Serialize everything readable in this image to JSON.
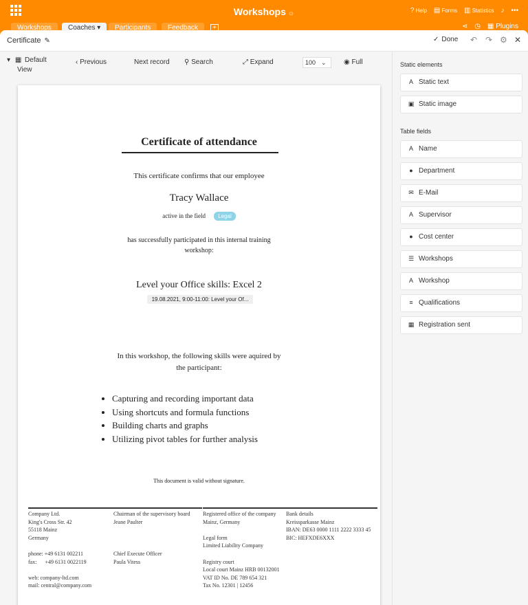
{
  "app": {
    "title": "Workshops",
    "title_icon": "☼"
  },
  "topbar": {
    "items": [
      {
        "icon": "?",
        "label": "Help"
      },
      {
        "icon": "▤",
        "label": "Forms"
      },
      {
        "icon": "▥",
        "label": "Statistics"
      },
      {
        "icon": "♪",
        "label": ""
      },
      {
        "icon": "•••",
        "label": ""
      }
    ]
  },
  "tabs": [
    {
      "label": "Workshops"
    },
    {
      "label": "Coaches ▾"
    },
    {
      "label": "Participants"
    },
    {
      "label": "Feedback"
    }
  ],
  "tabs_right": {
    "plugins": "Plugins"
  },
  "modal": {
    "title": "Certificate",
    "done": "Done",
    "check": "✓",
    "pen": "✎"
  },
  "toolbar": {
    "view": "Default",
    "view2": "View",
    "previous": "Previous",
    "next": "Next record",
    "search": "Search",
    "expand": "Expand",
    "zoom": "100",
    "full": "Full"
  },
  "certificate": {
    "title": "Certificate of attendance",
    "confirm": "This certificate confirms that our employee",
    "name": "Tracy Wallace",
    "field": "active in the field",
    "field_value": "Legal",
    "participated_1": "has successfully participated in this internal training",
    "participated_2": "workshop:",
    "workshop": "Level your Office skills: Excel 2",
    "workshop_date": "19.08.2021, 9:00-11:00: Level your Of...",
    "skills_intro_1": "In this workshop, the following skills were aquired by",
    "skills_intro_2": "the participant:",
    "skills": [
      "Capturing and recording important data",
      "Using shortcuts and formula functions",
      "Building charts and graphs",
      "Utilizing pivot tables for further analysis"
    ],
    "valid": "This document is valid without signature."
  },
  "footer": {
    "col1": [
      "Company Ltd.",
      "King's Cross Str. 42",
      "55118 Mainz",
      "Germany",
      "",
      "phone: +49 6131 002211",
      "fax:      +49 6131 0022119",
      "",
      "web: company-ltd.com",
      "mail: central@company.com"
    ],
    "col2": [
      "Chairman of the supervisory board",
      "Jeane Paulter",
      "",
      "",
      "",
      "Chief Execute Officer",
      "Paula Vitess"
    ],
    "col3": [
      "Registered office of the company",
      "Mainz, Germany",
      "",
      "Legal form",
      "Limited Liability Company",
      "",
      "Registry court",
      "Local court Mainz HRB 00132001",
      "VAT ID No. DE 789 654 321",
      "Tax No. 12301 | 12456"
    ],
    "col4": [
      "Bank details",
      "Kreissparkasse Mainz",
      "IBAN: DE63 0000 1111 2222 3333 45",
      "BIC: HEFXDE6XXX"
    ]
  },
  "rpanel": {
    "static_title": "Static elements",
    "static": [
      {
        "icon": "A",
        "label": "Static text"
      },
      {
        "icon": "▣",
        "label": "Static image"
      }
    ],
    "fields_title": "Table fields",
    "fields": [
      {
        "icon": "A",
        "label": "Name"
      },
      {
        "icon": "●",
        "label": "Department"
      },
      {
        "icon": "✉",
        "label": "E-Mail"
      },
      {
        "icon": "A",
        "label": "Supervisor"
      },
      {
        "icon": "●",
        "label": "Cost center"
      },
      {
        "icon": "☰",
        "label": "Workshops"
      },
      {
        "icon": "A",
        "label": "Workshop"
      },
      {
        "icon": "≡",
        "label": "Qualifications"
      },
      {
        "icon": "▦",
        "label": "Registration sent"
      }
    ]
  }
}
